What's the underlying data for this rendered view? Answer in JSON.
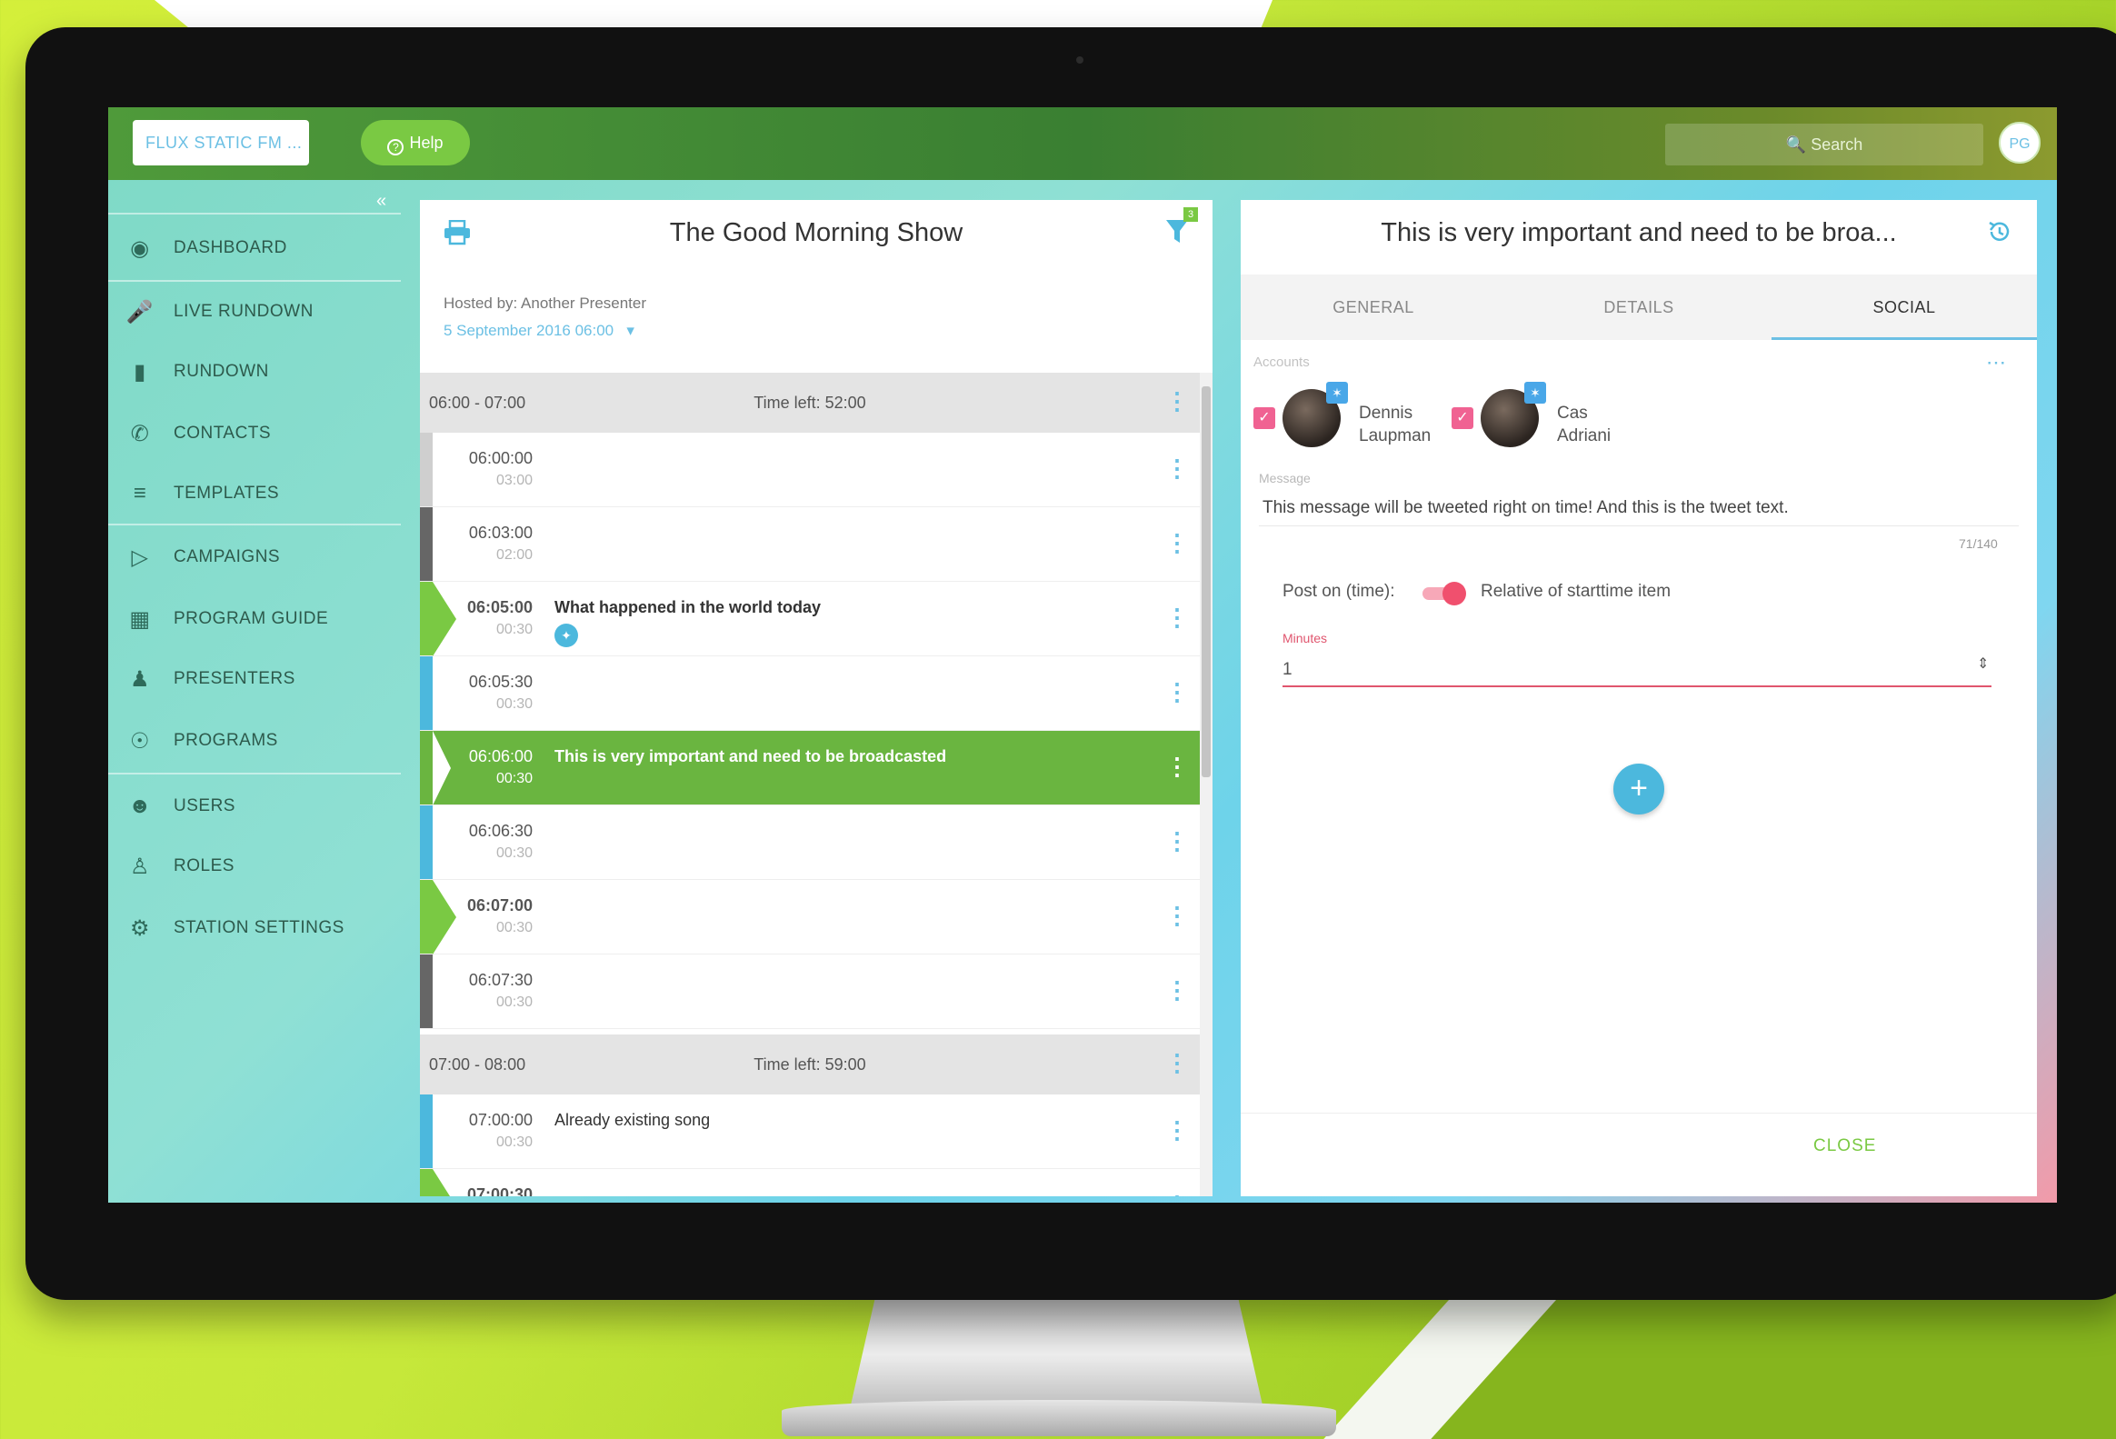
{
  "topbar": {
    "station": "FLUX STATIC FM ...",
    "help": "Help",
    "search_placeholder": "Search",
    "user_initials": "PG"
  },
  "sidebar": {
    "collapse": "«",
    "items": [
      {
        "label": "DASHBOARD",
        "icon": "dashboard-icon"
      },
      {
        "label": "LIVE RUNDOWN",
        "icon": "microphone-icon"
      },
      {
        "label": "RUNDOWN",
        "icon": "document-icon"
      },
      {
        "label": "CONTACTS",
        "icon": "phone-icon"
      },
      {
        "label": "TEMPLATES",
        "icon": "templates-icon"
      },
      {
        "label": "CAMPAIGNS",
        "icon": "megaphone-icon"
      },
      {
        "label": "PROGRAM GUIDE",
        "icon": "calendar-icon"
      },
      {
        "label": "PRESENTERS",
        "icon": "presenter-icon"
      },
      {
        "label": "PROGRAMS",
        "icon": "broadcast-icon"
      },
      {
        "label": "USERS",
        "icon": "users-icon"
      },
      {
        "label": "ROLES",
        "icon": "roles-icon"
      },
      {
        "label": "STATION SETTINGS",
        "icon": "gear-icon"
      }
    ]
  },
  "rundown": {
    "title": "The Good Morning Show",
    "filter_badge": "3",
    "hosted_by": "Hosted by: Another Presenter",
    "date": "5 September 2016 06:00",
    "hours": [
      {
        "range": "06:00 - 07:00",
        "time_left": "Time left: 52:00"
      },
      {
        "range": "07:00 - 08:00",
        "time_left": "Time left: 59:00"
      }
    ],
    "items": [
      {
        "start": "06:00:00",
        "dur": "03:00",
        "label": "",
        "bar": "#cfcfcf",
        "marker": "none"
      },
      {
        "start": "06:03:00",
        "dur": "02:00",
        "label": "",
        "bar": "#666666",
        "marker": "none"
      },
      {
        "start": "06:05:00",
        "dur": "00:30",
        "label": "What happened in the world today",
        "bar": "#7ac943",
        "marker": "arrow",
        "bold": true
      },
      {
        "start": "06:05:30",
        "dur": "00:30",
        "label": "",
        "bar": "#4cb8dd",
        "marker": "none"
      },
      {
        "start": "06:06:00",
        "dur": "00:30",
        "label": "This is very important and need to be broadcasted",
        "bar": "#6ab540",
        "marker": "arrow-white",
        "active": true
      },
      {
        "start": "06:06:30",
        "dur": "00:30",
        "label": "",
        "bar": "#4cb8dd",
        "marker": "none"
      },
      {
        "start": "06:07:00",
        "dur": "00:30",
        "label": "",
        "bar": "#7ac943",
        "marker": "arrow",
        "bold": true
      },
      {
        "start": "06:07:30",
        "dur": "00:30",
        "label": "",
        "bar": "#666666",
        "marker": "none"
      },
      {
        "start": "07:00:00",
        "dur": "00:30",
        "label": "Already existing song",
        "bar": "#4cb8dd",
        "marker": "none"
      },
      {
        "start": "07:00:30",
        "dur": "",
        "label": "",
        "bar": "#7ac943",
        "marker": "arrow",
        "bold": true
      }
    ]
  },
  "detail": {
    "title": "This is very important and need to be broa...",
    "tabs": [
      "GENERAL",
      "DETAILS",
      "SOCIAL"
    ],
    "active_tab": "SOCIAL",
    "accounts_label": "Accounts",
    "accounts": [
      {
        "first": "Dennis",
        "last": "Laupman"
      },
      {
        "first": "Cas",
        "last": "Adriani"
      }
    ],
    "message_label": "Message",
    "message": "This message will be tweeted right on time! And this is the tweet text.",
    "counter": "71/140",
    "post_on": "Post on (time):",
    "relative": "Relative of starttime item",
    "minutes_label": "Minutes",
    "minutes_value": "1",
    "add": "+",
    "close": "CLOSE"
  },
  "colors": {
    "accent_green": "#7ac943",
    "accent_blue": "#4cb8dd",
    "accent_pink": "#f0506e"
  }
}
